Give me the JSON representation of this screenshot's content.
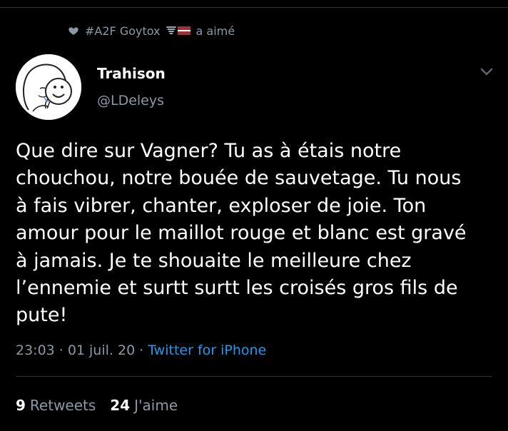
{
  "social_context": {
    "user": "#A2F Goytox",
    "action": "a aimé"
  },
  "tweet": {
    "display_name": "Trahison",
    "handle": "@LDeleys",
    "text": "Que dire sur Vagner? Tu as à étais notre\nchouchou, notre bouée de sauvetage. Tu nous\nà fais vibrer, chanter, exploser de joie. Ton\namour pour le maillot rouge et blanc est gravé\nà jamais. Je te shouaite le meilleure chez\nl’ennemie et surtt surtt les croisés gros fils de\npute!",
    "time": "23:03",
    "date": "01 juil. 20",
    "source": "Twitter for iPhone",
    "separator": "·"
  },
  "stats": {
    "retweets_count": "9",
    "retweets_label": "Retweets",
    "likes_count": "24",
    "likes_label": "J'aime"
  },
  "colors": {
    "background": "#000000",
    "secondary_text": "#8b98a5",
    "link": "#1d9bf0",
    "divider": "#2f3336"
  }
}
